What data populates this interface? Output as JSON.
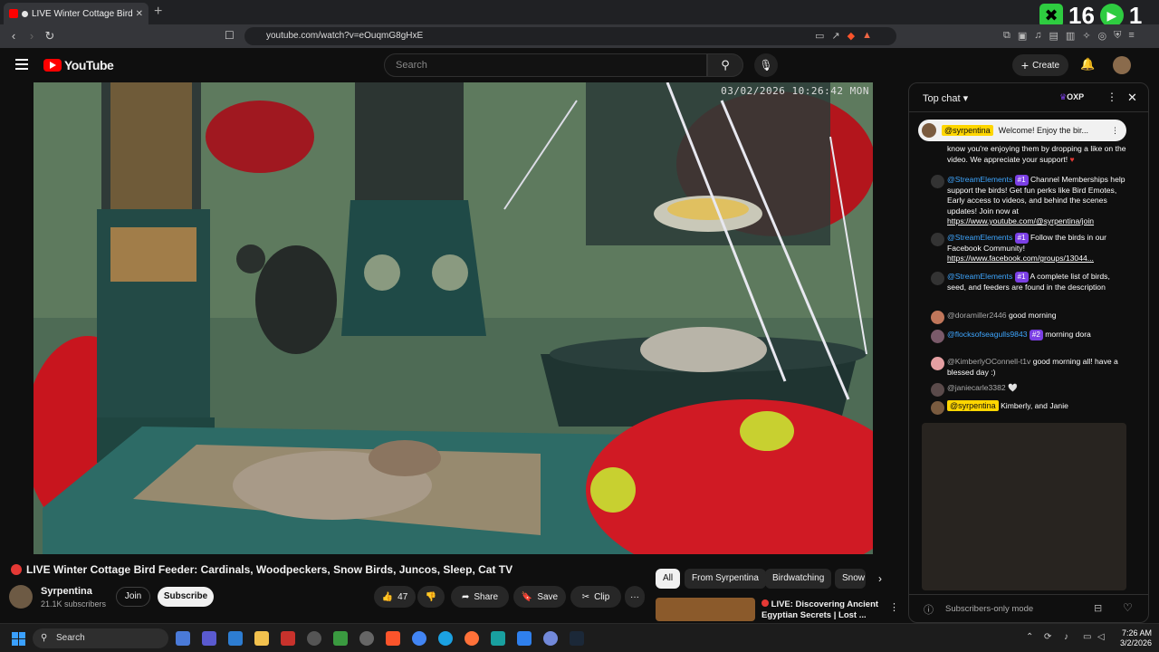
{
  "browser": {
    "tab_title": "LIVE Winter Cottage Bird F",
    "new_tab": "+",
    "url": "youtube.com/watch?v=eOuqmG8gHxE"
  },
  "overlay": {
    "count": "16",
    "right_count": "1"
  },
  "youtube": {
    "logo_text": "YouTube",
    "search_placeholder": "Search",
    "create_label": "Create"
  },
  "video": {
    "timestamp": "03/02/2026 10:26:42 MON",
    "title": "LIVE Winter Cottage Bird Feeder: Cardinals, Woodpeckers, Snow Birds, Juncos, Sleep, Cat TV",
    "channel_name": "Syrpentina",
    "subscribers": "21.1K subscribers",
    "join_label": "Join",
    "subscribe_label": "Subscribe",
    "likes": "47",
    "share_label": "Share",
    "save_label": "Save",
    "clip_label": "Clip",
    "more": "···"
  },
  "chips": [
    "All",
    "From Syrpentina",
    "Birdwatching",
    "Snow"
  ],
  "recommendation": {
    "title": "LIVE: Discovering Ancient Egyptian Secrets | Lost ..."
  },
  "chat": {
    "header_label": "Top chat",
    "oxp_label": "OXP",
    "pinned_author": "@syrpentina",
    "pinned_text": "Welcome! Enjoy the bir...",
    "continuation": "know you're enjoying them by dropping a like on the video. We appreciate your support!",
    "messages": [
      {
        "author": "@StreamElements",
        "badge": "#1",
        "text": "Channel Memberships help support the birds! Get fun perks like Bird Emotes, Early access to videos, and behind the scenes updates! Join now at",
        "link": "https://www.youtube.com/@syrpentina/join"
      },
      {
        "author": "@StreamElements",
        "badge": "#1",
        "text": "Follow the birds in our Facebook Community!",
        "link": "https://www.facebook.com/groups/13044..."
      },
      {
        "author": "@StreamElements",
        "badge": "#1",
        "text": "A complete list of birds, seed, and feeders are found in the description",
        "link": ""
      },
      {
        "author": "@doramiller2446",
        "badge": "",
        "text": "good morning",
        "link": ""
      },
      {
        "author": "@flocksofseagulls9843",
        "badge": "#2",
        "text": "morning dora",
        "link": ""
      },
      {
        "author": "@KimberlyOConnell-t1v",
        "badge": "",
        "text": "good morning all! have a blessed day :)",
        "link": ""
      },
      {
        "author": "@janiecarle3382",
        "badge": "",
        "text": "🤍",
        "link": ""
      },
      {
        "author": "@syrpentina",
        "badge": "",
        "text": "Kimberly, and Janie",
        "link": ""
      }
    ],
    "footer_placeholder": "Subscribers-only mode"
  },
  "taskbar": {
    "search_label": "Search",
    "time": "7:26 AM",
    "date": "3/2/2026"
  },
  "colors": {
    "accent_red": "#ff0000",
    "link_blue": "#3ea6ff",
    "member_purple": "#7b3fe4"
  }
}
